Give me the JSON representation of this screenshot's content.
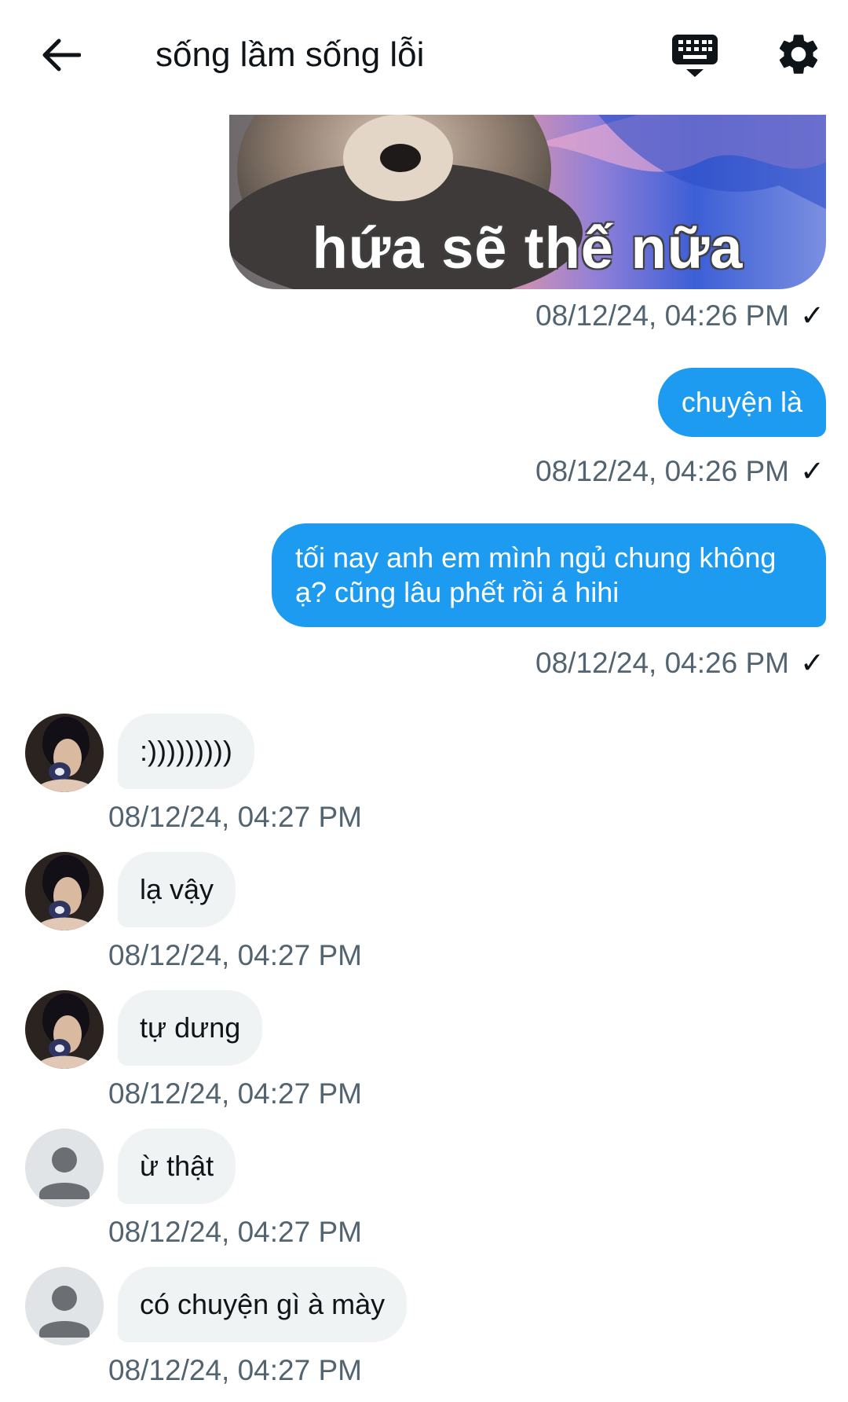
{
  "header": {
    "title": "sống lầm sống lỗi",
    "back_icon": "arrow-left-icon",
    "keyboard_icon": "keyboard-icon",
    "settings_icon": "gear-icon"
  },
  "colors": {
    "outgoing_bubble": "#1d9bf0",
    "incoming_bubble": "#eff3f4",
    "timestamp": "#536471"
  },
  "messages": [
    {
      "direction": "out",
      "type": "image",
      "image_caption": "hứa sẽ thế nữa",
      "timestamp": "08/12/24, 04:26 PM",
      "status": "✓"
    },
    {
      "direction": "out",
      "type": "text",
      "text": "chuyện là",
      "timestamp": "08/12/24, 04:26 PM",
      "status": "✓"
    },
    {
      "direction": "out",
      "type": "text",
      "text": "tối nay anh em mình ngủ chung không ạ? cũng lâu phết rồi á hihi",
      "timestamp": "08/12/24, 04:26 PM",
      "status": "✓"
    },
    {
      "direction": "in",
      "type": "text",
      "avatar": "photo",
      "text": ":)))))))))",
      "timestamp": "08/12/24, 04:27 PM"
    },
    {
      "direction": "in",
      "type": "text",
      "avatar": "photo",
      "text": "lạ vậy",
      "timestamp": "08/12/24, 04:27 PM"
    },
    {
      "direction": "in",
      "type": "text",
      "avatar": "photo",
      "text": "tự dưng",
      "timestamp": "08/12/24, 04:27 PM"
    },
    {
      "direction": "in",
      "type": "text",
      "avatar": "default",
      "text": "ừ thật",
      "timestamp": "08/12/24, 04:27 PM"
    },
    {
      "direction": "in",
      "type": "text",
      "avatar": "default",
      "text": "có chuyện gì à mày",
      "timestamp": "08/12/24, 04:27 PM"
    }
  ]
}
